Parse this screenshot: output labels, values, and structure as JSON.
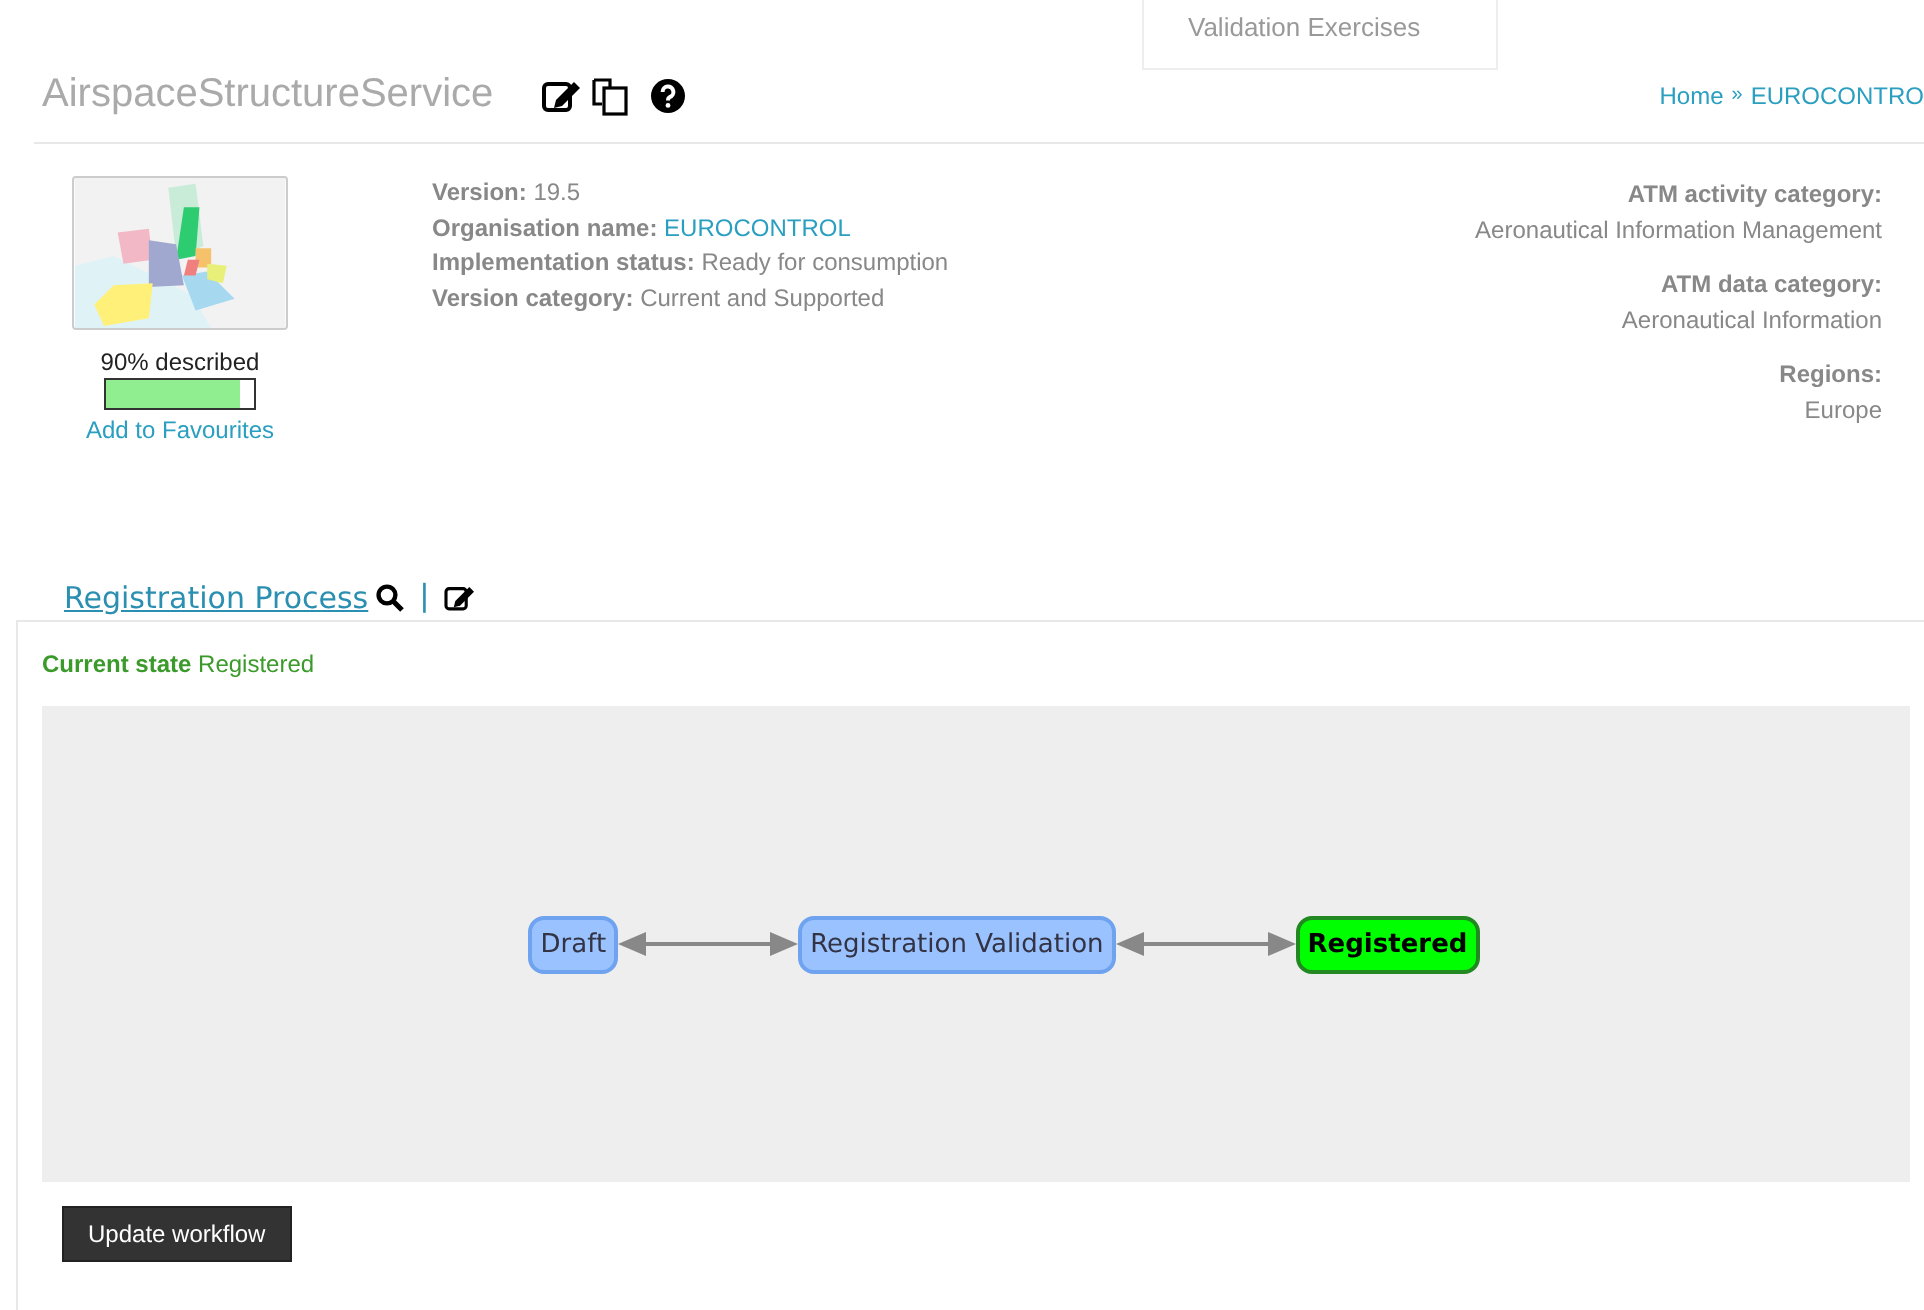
{
  "menu_fragment": {
    "label": "Validation Exercises"
  },
  "header": {
    "title": "AirspaceStructureService",
    "breadcrumb": [
      {
        "label": "Home"
      },
      {
        "label": "EUROCONTRO"
      }
    ],
    "breadcrumb_separator": "»"
  },
  "summary": {
    "described": "90% described",
    "level": 0.9,
    "favourites_link": "Add to Favourites"
  },
  "details": [
    {
      "label": "Version:",
      "value": "19.5",
      "kind": "text"
    },
    {
      "label": "Organisation name:",
      "value": "EUROCONTROL",
      "kind": "link"
    },
    {
      "label": "Implementation status:",
      "value": "Ready for consumption",
      "kind": "text"
    },
    {
      "label": "Version category:",
      "value": "Current and Supported",
      "kind": "text"
    }
  ],
  "categories": [
    {
      "label": "ATM activity category:",
      "value": "Aeronautical Information Management"
    },
    {
      "label": "ATM data category:",
      "value": "Aeronautical Information"
    },
    {
      "label": "Regions:",
      "value": "Europe"
    }
  ],
  "process": {
    "title": "Registration Process",
    "separator": "|",
    "current_state_label": "Current state",
    "current_state": "Registered",
    "states": [
      {
        "label": "Draft",
        "selected": false
      },
      {
        "label": "Registration Validation",
        "selected": false
      },
      {
        "label": "Registered",
        "selected": true
      }
    ],
    "button": "Update workflow"
  }
}
